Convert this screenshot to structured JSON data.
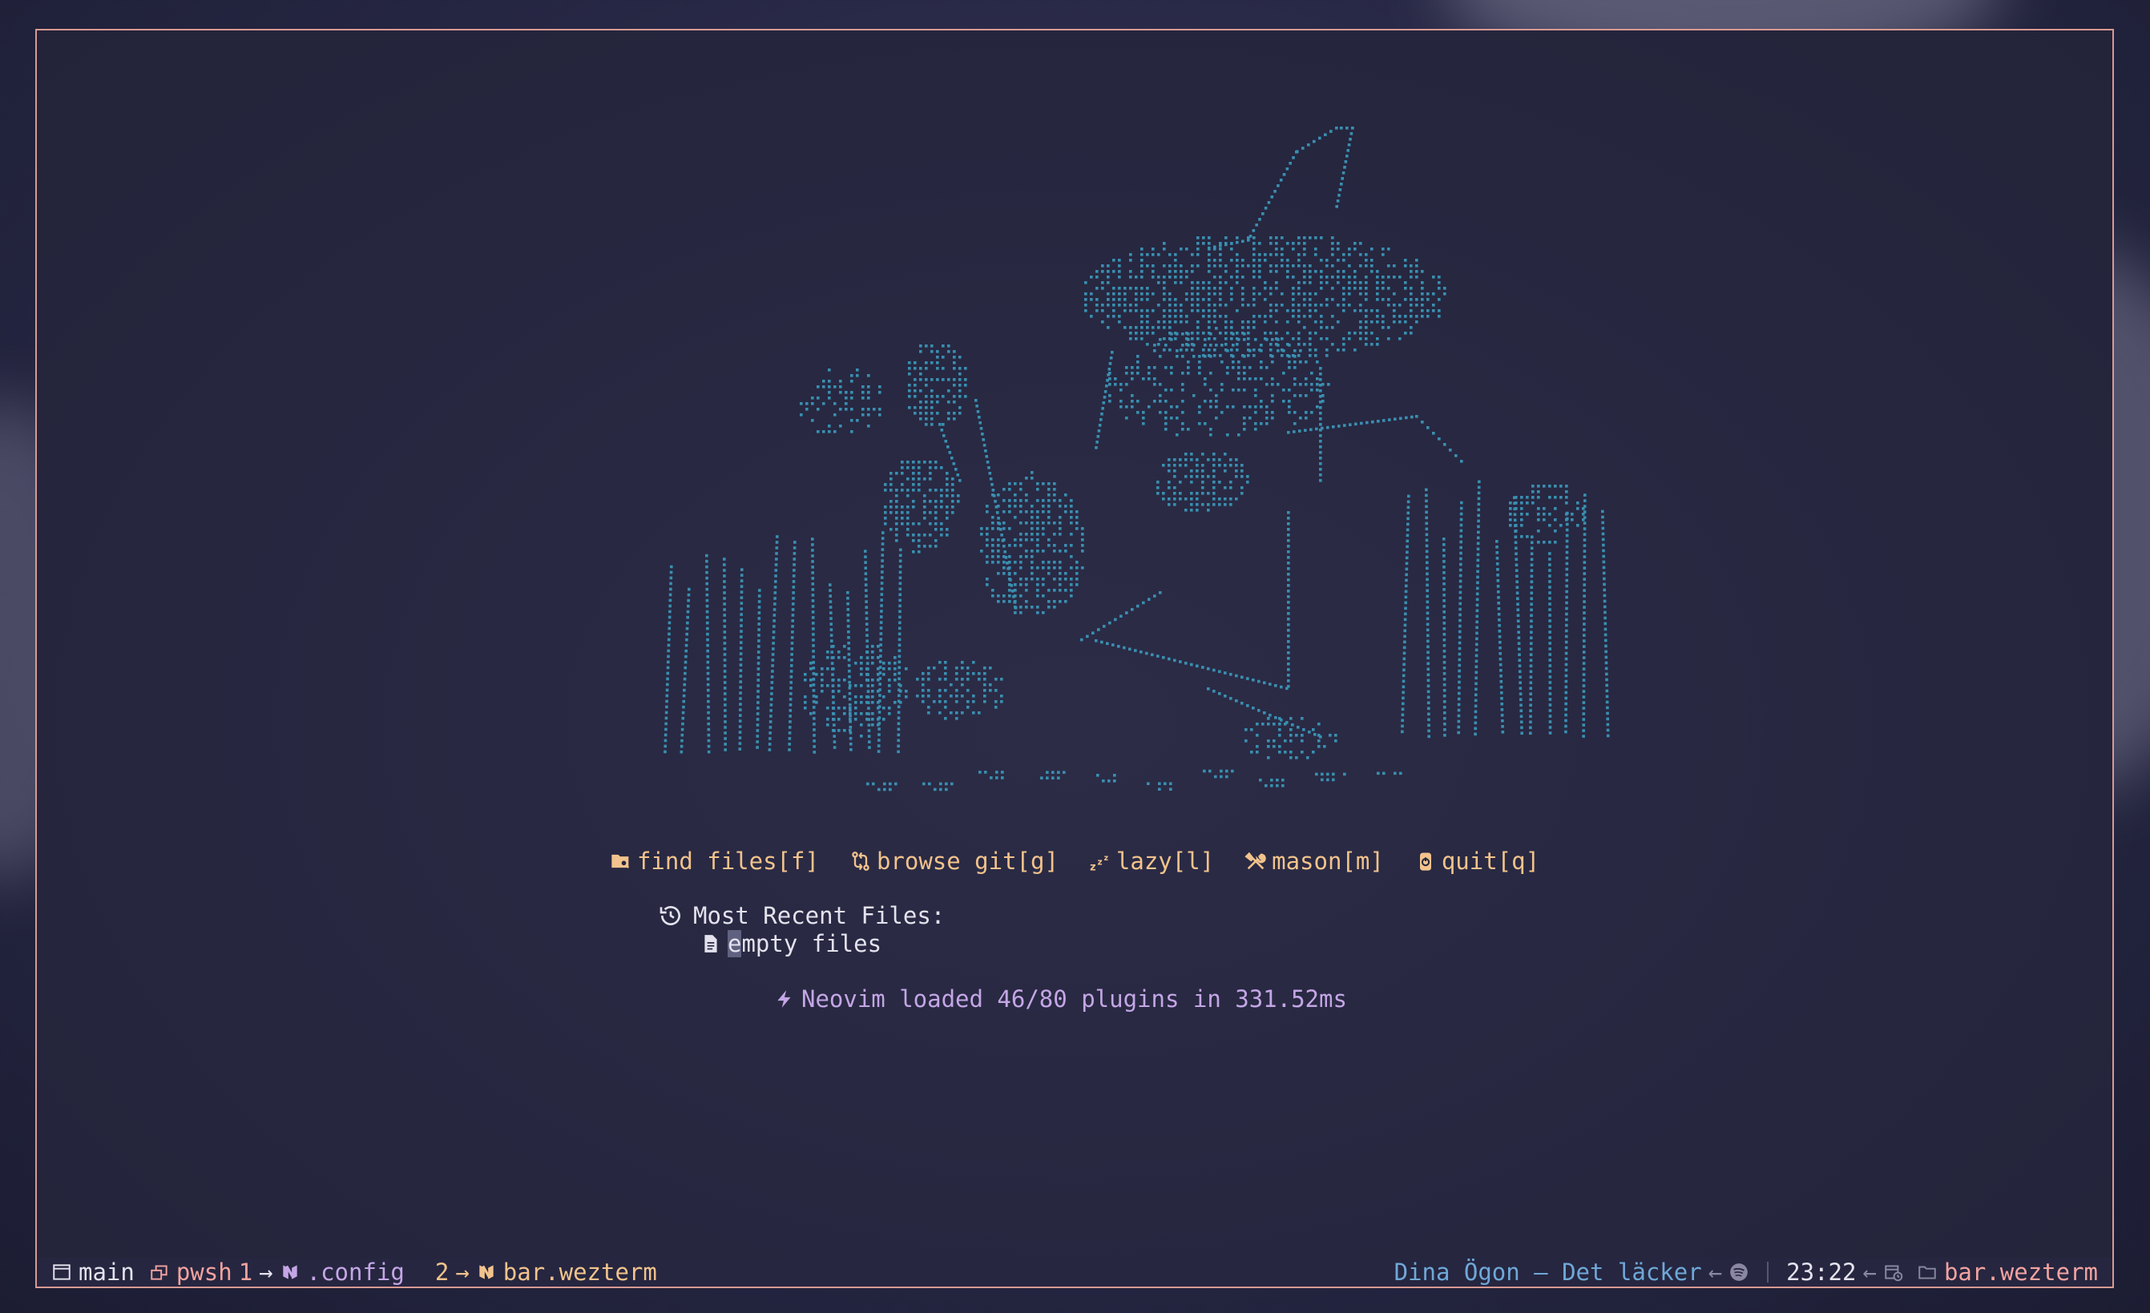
{
  "colors": {
    "border": "#d89a93",
    "ascii_art": "#3a8fb0",
    "menu": "#f2c38c",
    "text": "#e4e2ee",
    "startup": "#c4a6e6",
    "song": "#6fa8d8"
  },
  "dashboard": {
    "menu": [
      {
        "icon": "folder-search-icon",
        "label": "find files[f]"
      },
      {
        "icon": "git-compare-icon",
        "label": "browse git[g]"
      },
      {
        "icon": "sleep-icon",
        "label": "lazy[l]"
      },
      {
        "icon": "tools-icon",
        "label": "mason[m]"
      },
      {
        "icon": "power-icon",
        "label": "quit[q]"
      }
    ],
    "recent_title": "Most Recent Files:",
    "recent_empty_first": "e",
    "recent_empty_rest": "mpty files",
    "startup": "Neovim loaded 46/80 plugins in 331.52ms"
  },
  "statusbar": {
    "workspace": "main",
    "tab1_shell": "pwsh",
    "tab1_index": "1",
    "tab1_dir": ".config",
    "tab2_index": "2",
    "tab2_dir": "bar.wezterm",
    "song": "Dina Ögon – Det läcker",
    "time": "23:22",
    "cwd": "bar.wezterm"
  }
}
